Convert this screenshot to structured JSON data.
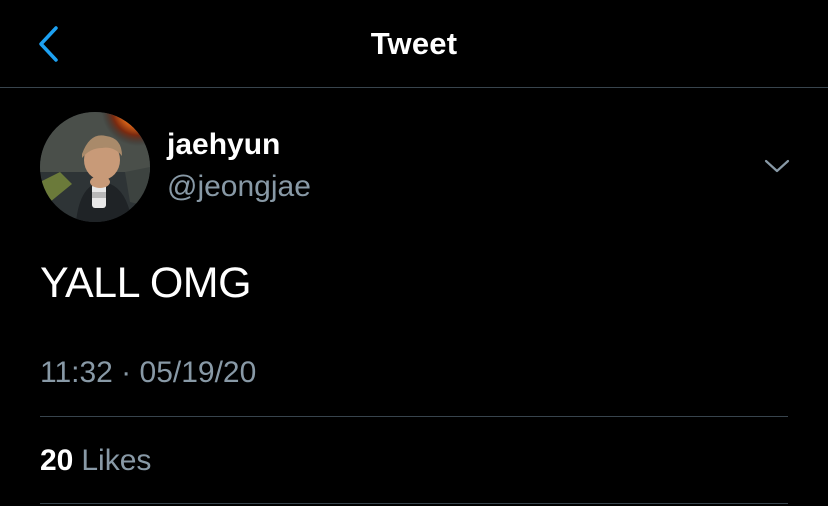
{
  "header": {
    "title": "Tweet"
  },
  "tweet": {
    "display_name": "jaehyun",
    "username": "@jeongjae",
    "text": "YALL OMG",
    "timestamp": "11:32 · 05/19/20",
    "likes_count": "20",
    "likes_label": "Likes"
  },
  "icons": {
    "back": "chevron-left-icon",
    "more": "chevron-down-icon"
  },
  "colors": {
    "accent": "#1da1f2",
    "secondary_text": "#8899a6",
    "divider": "#38444d",
    "background": "#000000"
  }
}
